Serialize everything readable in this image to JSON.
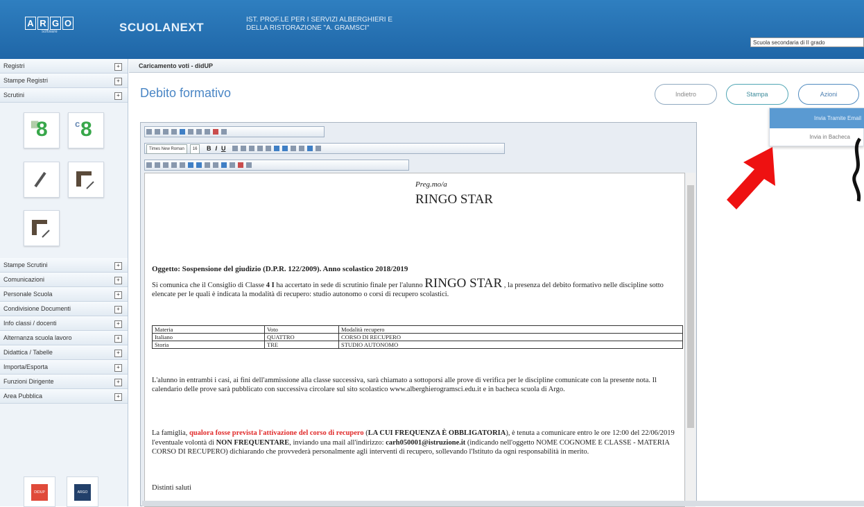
{
  "header": {
    "logo_letters": [
      "A",
      "R",
      "G",
      "O"
    ],
    "logo_sub": "software",
    "brand": "SCUOLANEXT",
    "school_line1": "IST. PROF.LE PER I SERVIZI ALBERGHIERI E",
    "school_line2": "DELLA RISTORAZIONE \"A. GRAMSCI\"",
    "school_type": "Scuola secondaria di II grado"
  },
  "sidebar": {
    "top_items": [
      "Registri",
      "Stampe Registri",
      "Scrutini"
    ],
    "bottom_items": [
      "Stampe Scrutini",
      "Comunicazioni",
      "Personale Scuola",
      "Condivisione Documenti",
      "Info classi / docenti",
      "Alternanza scuola lavoro",
      "Didattica / Tabelle",
      "Importa/Esporta",
      "Funzioni Dirigente",
      "Area Pubblica"
    ],
    "toggle_symbol": "+",
    "tile_digit": "8",
    "bottom_labels": [
      "DIDUP",
      "ARGO"
    ]
  },
  "main": {
    "breadcrumb": "Caricamento voti - didUP",
    "page_title": "Debito formativo",
    "buttons": {
      "back": "Indietro",
      "print": "Stampa",
      "actions": "Azioni"
    },
    "actions_menu": [
      "Invia Tramite Email",
      "Invia in Bacheca"
    ]
  },
  "editor": {
    "font_name": "Times New Roman",
    "font_size": "16",
    "greeting": "Preg.mo/a",
    "student": "RINGO STAR",
    "subject_line": "Oggetto: Sospensione del giudizio (D.P.R. 122/2009).  Anno scolastico 2018/2019",
    "p1_a": "Si comunica che il Consiglio di Classe ",
    "p1_class": "4 I",
    "p1_b": " ha accertato in sede di scrutinio finale per l'alunno ",
    "p1_student": "RINGO STAR",
    "p1_c": " , la presenza del debito formativo nelle discipline sotto elencate per le quali è indicata la modalità di recupero: studio autonomo o corsi di recupero scolastici.",
    "table_headers": [
      "Materia",
      "Voto",
      "Modalità recupero"
    ],
    "table_rows": [
      [
        "Italiano",
        "QUATTRO",
        "CORSO DI RECUPERO"
      ],
      [
        "Storia",
        "TRE",
        "STUDIO AUTONOMO"
      ]
    ],
    "p2": "L'alunno in entrambi i casi, ai fini dell'ammissione alla classe successiva, sarà chiamato a sottoporsi alle prove di verifica per le discipline comunicate con la presente nota. Il calendario delle prove sarà pubblicato con successiva circolare sul sito scolastico www.alberghierogramsci.edu.it e in bacheca scuola di Argo.",
    "p3_a": "La famiglia, ",
    "p3_red": "qualora fosse prevista l'attivazione del corso di recupero",
    "p3_b": " (",
    "p3_bold1": "LA CUI FREQUENZA È OBBLIGATORIA",
    "p3_c": "), è tenuta a comunicare entro le ore 12:00 del 22/06/2019 l'eventuale volontà di ",
    "p3_bold2": "NON FREQUENTARE",
    "p3_d": ", inviando una mail all'indirizzo: ",
    "p3_email": "carh050001@istruzione.it",
    "p3_e": " (indicando nell'oggetto NOME COGNOME E CLASSE - MATERIA CORSO DI RECUPERO) dichiarando che provvederà personalmente agli interventi di recupero, sollevando l'Istituto da ogni responsabilità in merito.",
    "closing": "Distinti saluti"
  },
  "colors": {
    "header": "#2470b3",
    "accent": "#4a86c5",
    "menu_highlight": "#5a9ad2",
    "annotation_arrow": "#ee1111"
  }
}
